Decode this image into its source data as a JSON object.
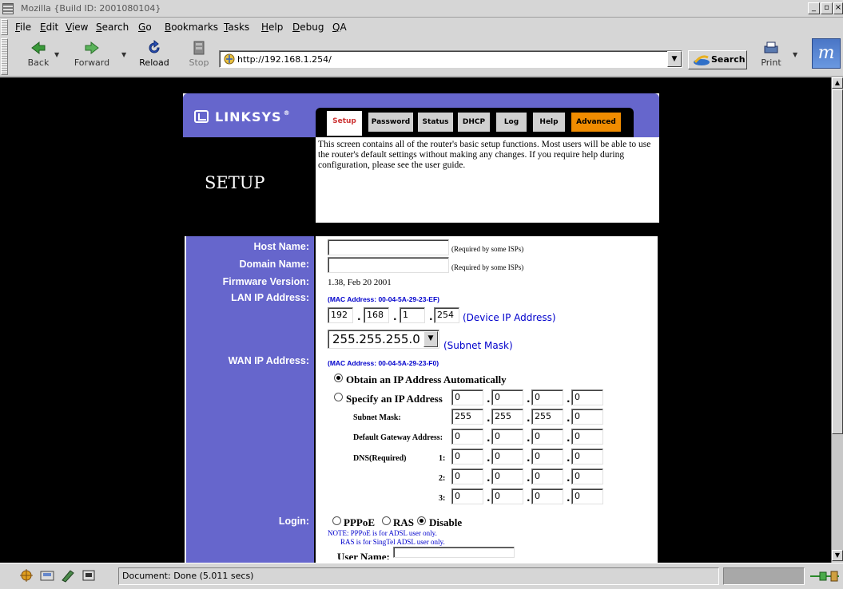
{
  "window": {
    "title": "Mozilla {Build ID: 2001080104}"
  },
  "menu": [
    {
      "label": "File",
      "u": "F",
      "rest": "ile"
    },
    {
      "label": "Edit",
      "u": "E",
      "rest": "dit"
    },
    {
      "label": "View",
      "u": "V",
      "rest": "iew"
    },
    {
      "label": "Search",
      "u": "S",
      "rest": "earch"
    },
    {
      "label": "Go",
      "u": "G",
      "rest": "o"
    },
    {
      "label": "Bookmarks",
      "u": "B",
      "rest": "ookmarks"
    },
    {
      "label": "Tasks",
      "u": "T",
      "rest": "asks"
    },
    {
      "label": "Help",
      "u": "H",
      "rest": "elp"
    },
    {
      "label": "Debug",
      "u": "D",
      "rest": "ebug"
    },
    {
      "label": "QA",
      "u": "Q",
      "rest": "A"
    }
  ],
  "nav": {
    "back": "Back",
    "forward": "Forward",
    "reload": "Reload",
    "stop": "Stop",
    "search": "Search",
    "print": "Print"
  },
  "url": "http://192.168.1.254/",
  "page": {
    "brand": "LINKSYS",
    "tabs": [
      "Setup",
      "Password",
      "Status",
      "DHCP",
      "Log",
      "Help",
      "Advanced"
    ],
    "title": "SETUP",
    "intro": "This screen contains all of the router's basic setup functions. Most users will be able to use the router's default settings without making any changes. If you require help during configuration, please see the user guide.",
    "labels": {
      "host": "Host Name:",
      "domain": "Domain Name:",
      "firmware": "Firmware Version:",
      "lan": "LAN IP Address:",
      "wan": "WAN IP Address:",
      "login": "Login:"
    },
    "required_note": "(Required by some ISPs)",
    "firmware_value": "1.38, Feb 20 2001",
    "lan_mac": "(MAC Address: 00-04-5A-29-23-EF)",
    "lan_ip": [
      "192",
      "168",
      "1",
      "254"
    ],
    "device_ip_label": "(Device IP Address)",
    "subnet_value": "255.255.255.0",
    "subnet_label": "(Subnet Mask)",
    "wan_mac": "(MAC Address: 00-04-5A-29-23-F0)",
    "obtain_auto": "Obtain an IP Address Automatically",
    "specify_ip": "Specify an IP Address",
    "wan_ip": [
      "0",
      "0",
      "0",
      "0"
    ],
    "subnet_mask_label": "Subnet Mask:",
    "wan_subnet": [
      "255",
      "255",
      "255",
      "0"
    ],
    "gateway_label": "Default Gateway Address:",
    "gateway": [
      "0",
      "0",
      "0",
      "0"
    ],
    "dns_label": "DNS(Required)",
    "dns_nums": [
      "1:",
      "2:",
      "3:"
    ],
    "dns1": [
      "0",
      "0",
      "0",
      "0"
    ],
    "dns2": [
      "0",
      "0",
      "0",
      "0"
    ],
    "dns3": [
      "0",
      "0",
      "0",
      "0"
    ],
    "login_opts": [
      "PPPoE",
      "RAS",
      "Disable"
    ],
    "note_line1": "NOTE: PPPoE is for ADSL user only.",
    "note_line2": "RAS is for SingTel ADSL user only.",
    "user_name_partial": "User Name:"
  },
  "status": "Document: Done (5.011 secs)"
}
